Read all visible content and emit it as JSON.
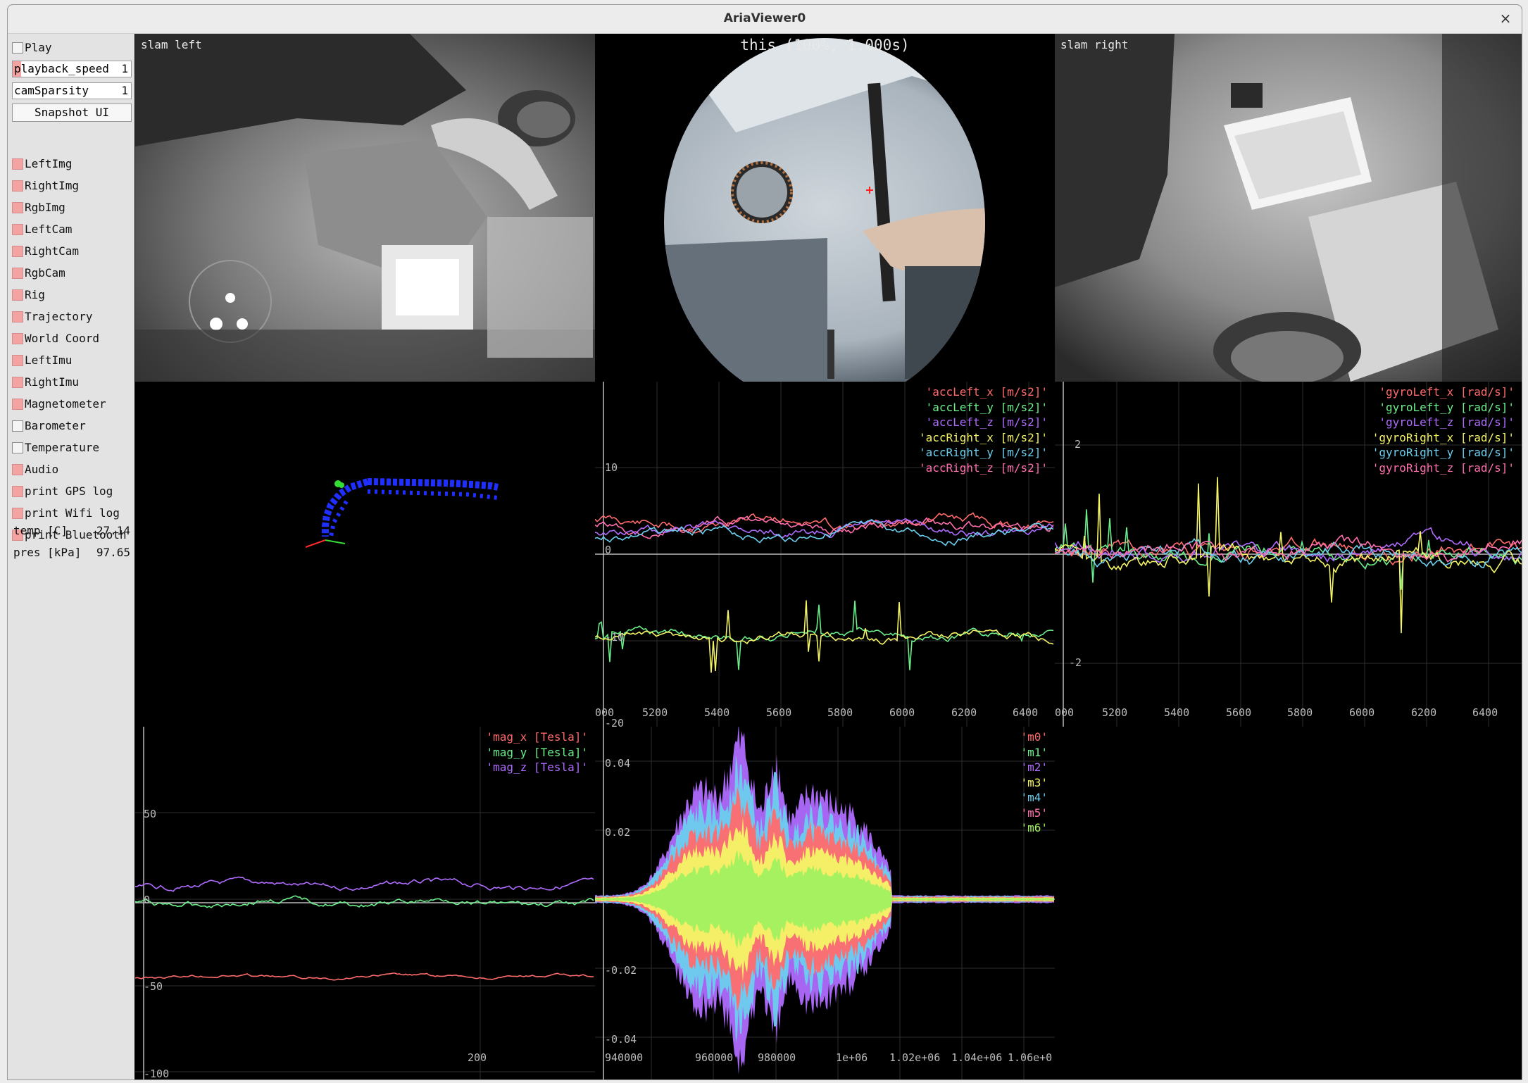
{
  "window": {
    "title": "AriaViewer0",
    "close_glyph": "×"
  },
  "sidebar": {
    "play_label": "Play",
    "playback_speed": {
      "label": "playback_speed",
      "value": "1"
    },
    "cam_sparsity": {
      "label": "camSparsity",
      "value": "1"
    },
    "snapshot_label": "Snapshot UI",
    "toggles": [
      {
        "label": "LeftImg",
        "checked": true
      },
      {
        "label": "RightImg",
        "checked": true
      },
      {
        "label": "RgbImg",
        "checked": true
      },
      {
        "label": "LeftCam",
        "checked": true
      },
      {
        "label": "RightCam",
        "checked": true
      },
      {
        "label": "RgbCam",
        "checked": true
      },
      {
        "label": "Rig",
        "checked": true
      },
      {
        "label": "Trajectory",
        "checked": true
      },
      {
        "label": "World Coord",
        "checked": true
      },
      {
        "label": "LeftImu",
        "checked": true
      },
      {
        "label": "RightImu",
        "checked": true
      },
      {
        "label": "Magnetometer",
        "checked": true
      },
      {
        "label": "Barometer",
        "checked": false
      },
      {
        "label": "Temperature",
        "checked": false
      },
      {
        "label": "Audio",
        "checked": true
      },
      {
        "label": "print GPS log",
        "checked": true
      },
      {
        "label": "print Wifi log",
        "checked": true
      },
      {
        "label": "print Bluetooth",
        "checked": true
      }
    ],
    "temp": {
      "label": "temp [C]",
      "value": "27.14"
    },
    "pres": {
      "label": "pres [kPa]",
      "value": "97.65"
    }
  },
  "cameras": {
    "slam_left": "slam left",
    "rgb": "this (100%, 1.000s)",
    "slam_right": "slam right"
  },
  "colors": {
    "x": "#ff6b6b",
    "y": "#6bef8a",
    "z": "#b06cff",
    "rx": "#f4f466",
    "ry": "#6bcfee",
    "rz": "#ff6fae",
    "m6": "#a0f060",
    "axis": "#bbbbbb",
    "trajectory": "#1f2fff"
  },
  "acc_plot": {
    "legend": [
      "'accLeft_x [m/s2]'",
      "'accLeft_y [m/s2]'",
      "'accLeft_z [m/s2]'",
      "'accRight_x [m/s2]'",
      "'accRight_y [m/s2]'",
      "'accRight_z [m/s2]'"
    ],
    "y_ticks": [
      "10",
      "0",
      "-10",
      "-20"
    ],
    "x_ticks": [
      "000",
      "5200",
      "5400",
      "5600",
      "5800",
      "6000",
      "6200",
      "6400"
    ]
  },
  "gyro_plot": {
    "legend": [
      "'gyroLeft_x [rad/s]'",
      "'gyroLeft_y [rad/s]'",
      "'gyroLeft_z [rad/s]'",
      "'gyroRight_x [rad/s]'",
      "'gyroRight_y [rad/s]'",
      "'gyroRight_z [rad/s]'"
    ],
    "y_ticks": [
      "2",
      "-2"
    ],
    "x_ticks": [
      "000",
      "5200",
      "5400",
      "5600",
      "5800",
      "6000",
      "6200",
      "6400"
    ]
  },
  "mag_plot": {
    "legend": [
      "'mag_x [Tesla]'",
      "'mag_y [Tesla]'",
      "'mag_z [Tesla]'"
    ],
    "y_ticks": [
      "50",
      "0",
      "-50",
      "-100"
    ],
    "x_ticks": [
      "200"
    ]
  },
  "audio_plot": {
    "legend": [
      "'m0'",
      "'m1'",
      "'m2'",
      "'m3'",
      "'m4'",
      "'m5'",
      "'m6'"
    ],
    "y_ticks": [
      "0.04",
      "0.02",
      "-0.02",
      "-0.04"
    ],
    "x_ticks": [
      "940000",
      "960000",
      "980000",
      "1e+06",
      "1.02e+06",
      "1.04e+06",
      "1.06e+0"
    ]
  }
}
